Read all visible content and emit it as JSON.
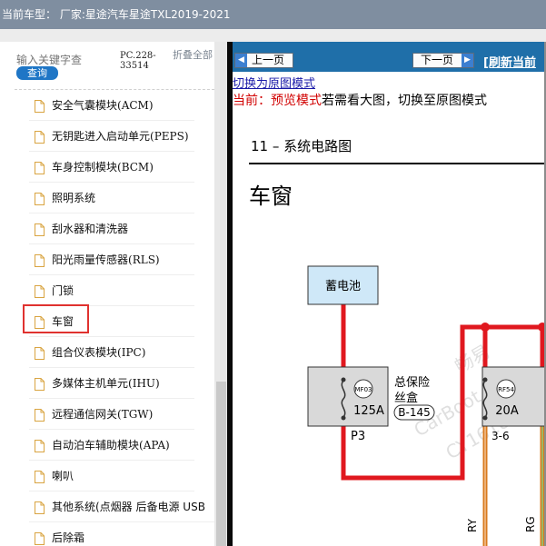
{
  "window": {
    "title": "当前车型：  厂家:星途汽车星途TXL2019-2021"
  },
  "left_panel": {
    "search_placeholder": "输入关键字查",
    "search_button": "查询",
    "pc_code": "PC.228-33514",
    "collapse_all": "折叠全部",
    "tree_items": [
      {
        "label": "安全气囊模块",
        "abbr": "(ACM)"
      },
      {
        "label": "无钥匙进入启动单元",
        "abbr": "(PEPS)"
      },
      {
        "label": "车身控制模块",
        "abbr": "(BCM)"
      },
      {
        "label": "照明系统",
        "abbr": ""
      },
      {
        "label": "刮水器和清洗器",
        "abbr": ""
      },
      {
        "label": "阳光雨量传感器",
        "abbr": "(RLS)"
      },
      {
        "label": "门锁",
        "abbr": ""
      },
      {
        "label": "车窗",
        "abbr": ""
      },
      {
        "label": "组合仪表模块",
        "abbr": "(IPC)"
      },
      {
        "label": "多媒体主机单元",
        "abbr": "(IHU)"
      },
      {
        "label": "远程通信网关",
        "abbr": "(TGW)"
      },
      {
        "label": "自动泊车辅助模块",
        "abbr": "(APA)"
      },
      {
        "label": "喇叭",
        "abbr": ""
      },
      {
        "label": "其他系统(点烟器 后备电源 USB",
        "abbr": ""
      },
      {
        "label": "后除霜",
        "abbr": ""
      }
    ],
    "selected_item": "车窗"
  },
  "right_panel": {
    "prev_button": "上一页",
    "next_button": "下一页",
    "refresh_link": "[刷新当前",
    "switch_link": "切换为原图模式",
    "mode_current": "当前：",
    "mode_name": "预览模式",
    "mode_hint": "若需看大图，切换至原图模式",
    "section_title": "11 – 系统电路图",
    "page_title": "车窗"
  },
  "diagram": {
    "battery": "蓄电池",
    "main_fuse_code": "MF03",
    "main_fuse_amp": "125A",
    "main_fuse_label_1": "总保险",
    "main_fuse_label_2": "丝盒",
    "main_fuse_connector": "B-145",
    "main_fuse_pin": "P3",
    "fuse2_code": "RF54",
    "fuse2_amp": "20A",
    "fuse2_pin": "3-6",
    "wire1": "RY",
    "wire2": "RG",
    "watermark_1": "畅易",
    "watermark_2": "CarBoot",
    "watermark_3": "CY1618",
    "colors": {
      "wire_red": "#e0181f",
      "wire_orange": "#d87a1e",
      "battery_fill": "#cfe8f8",
      "fuse_fill": "#d9d9d9"
    }
  }
}
